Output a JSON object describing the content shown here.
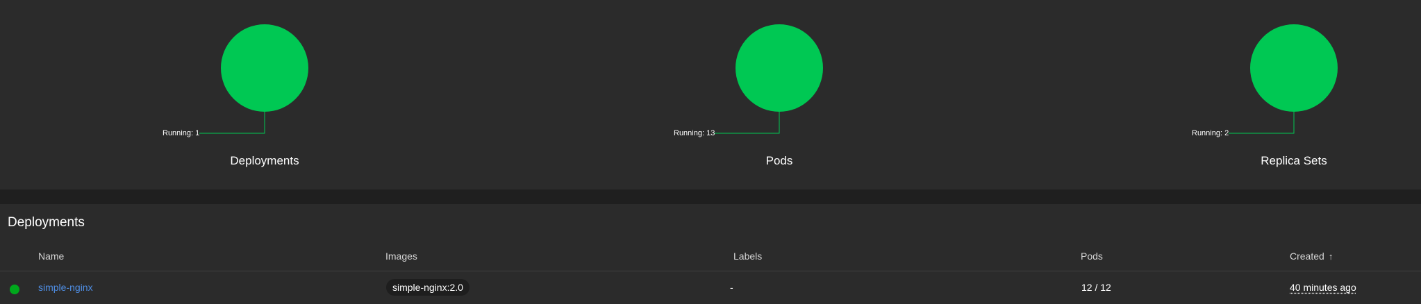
{
  "colors": {
    "running": "#00c853",
    "status_ok": "#00a81c",
    "link": "#4f8fe6",
    "background": "#2b2b2b"
  },
  "workloads": [
    {
      "title": "Deployments",
      "legend": "Running: 1"
    },
    {
      "title": "Pods",
      "legend": "Running: 13"
    },
    {
      "title": "Replica Sets",
      "legend": "Running: 2"
    }
  ],
  "deployments": {
    "title": "Deployments",
    "columns": {
      "name": "Name",
      "images": "Images",
      "labels": "Labels",
      "pods": "Pods",
      "created": "Created",
      "created_sort_icon": "arrow-up-icon"
    },
    "rows": [
      {
        "status": "running",
        "name": "simple-nginx",
        "image": "simple-nginx:2.0",
        "labels": "-",
        "pods": "12 / 12",
        "created": "40 minutes ago"
      }
    ]
  }
}
